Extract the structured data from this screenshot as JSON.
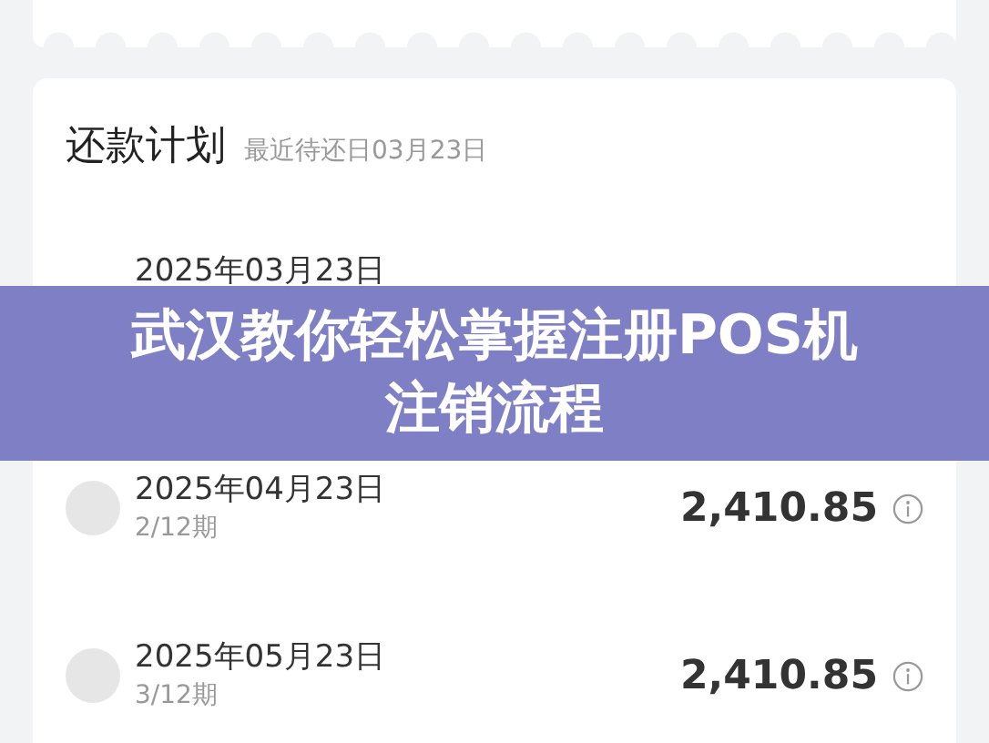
{
  "plan": {
    "title": "还款计划",
    "subtitle": "最近待还日03月23日",
    "rows": [
      {
        "date": "2025年03月23日"
      },
      {
        "date": "2025年04月23日",
        "period": "2/12期",
        "amount": "2,410.85"
      },
      {
        "date": "2025年05月23日",
        "period": "3/12期",
        "amount": "2,410.85"
      }
    ]
  },
  "banner": {
    "lines": [
      "武汉教你轻松掌握注册POS机",
      "注销流程"
    ]
  }
}
